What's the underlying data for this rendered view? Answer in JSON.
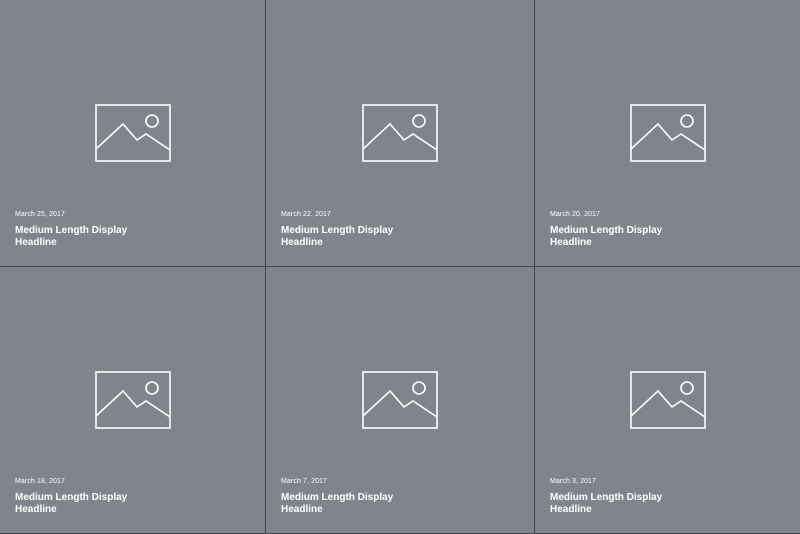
{
  "colors": {
    "card_background": "#80858d",
    "grid_gap": "#3f4650",
    "text": "#ffffff"
  },
  "cards": [
    {
      "icon": "image-placeholder-icon",
      "date": "March 25, 2017",
      "headline": "Medium Length Display Headline"
    },
    {
      "icon": "image-placeholder-icon",
      "date": "March 22, 2017",
      "headline": "Medium Length Display Headline"
    },
    {
      "icon": "image-placeholder-icon",
      "date": "March 20, 2017",
      "headline": "Medium Length Display Headline"
    },
    {
      "icon": "image-placeholder-icon",
      "date": "March 18, 2017",
      "headline": "Medium Length Display Headline"
    },
    {
      "icon": "image-placeholder-icon",
      "date": "March 7, 2017",
      "headline": "Medium Length Display Headline"
    },
    {
      "icon": "image-placeholder-icon",
      "date": "March 3, 2017",
      "headline": "Medium Length Display Headline"
    }
  ]
}
